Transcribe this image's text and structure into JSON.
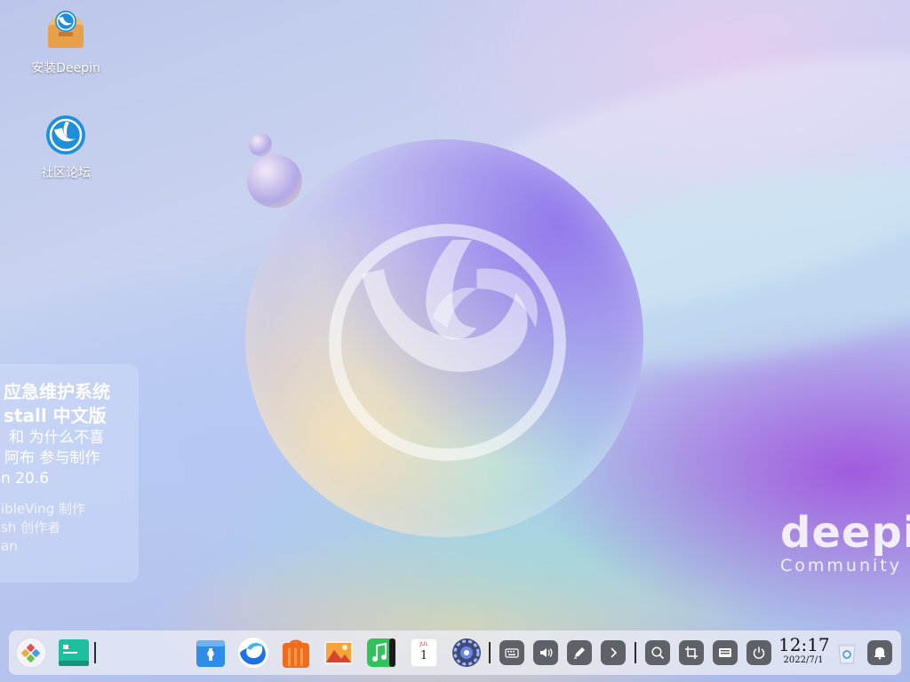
{
  "desktop": {
    "icons": [
      {
        "label": "安装Deepin"
      },
      {
        "label": "社区论坛"
      }
    ]
  },
  "wallpaper": {
    "brand_name": "deepin",
    "brand_sub": "Community"
  },
  "info_card": {
    "lines": [
      "应急维护系统",
      "stall 中文版",
      "和 为什么不喜",
      "阿布 参与制作",
      "n 20.6",
      "ibleVing 制作",
      "sh 创作者",
      "an"
    ]
  },
  "dock": {
    "apps": [
      {
        "name": "launcher-icon"
      },
      {
        "name": "terminal-icon"
      },
      {
        "name": "file-manager-icon"
      },
      {
        "name": "browser-icon"
      },
      {
        "name": "app-store-icon"
      },
      {
        "name": "image-viewer-icon"
      },
      {
        "name": "music-icon"
      },
      {
        "name": "calendar-icon",
        "calendar_month": "JUL",
        "calendar_day": "1"
      },
      {
        "name": "control-center-icon"
      }
    ],
    "tray": [
      "keyboard-icon",
      "volume-icon",
      "pen-icon",
      "chevron-right-icon",
      "search-icon",
      "screenshot-icon",
      "input-method-icon",
      "power-icon"
    ],
    "clock": {
      "time": "12:17",
      "date": "2022/7/1"
    }
  }
}
